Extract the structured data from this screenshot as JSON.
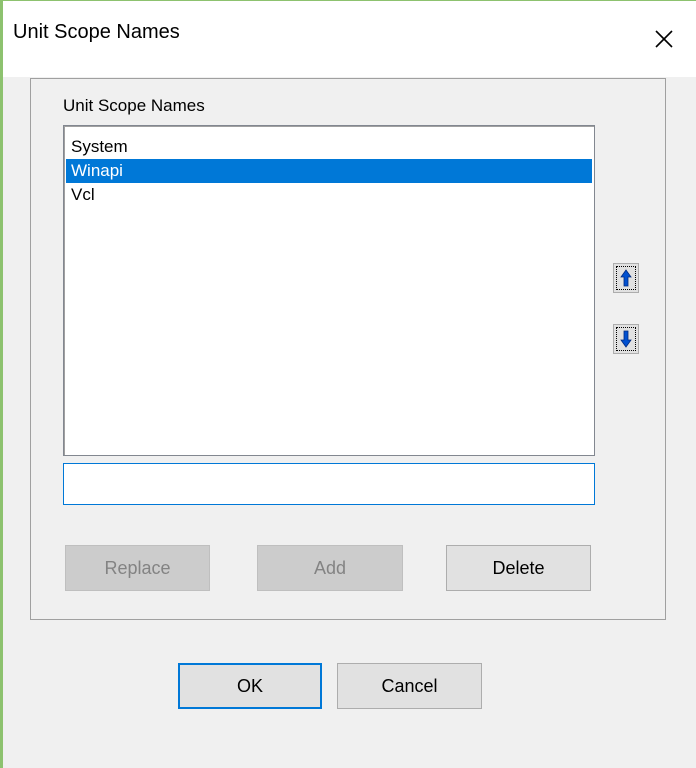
{
  "window": {
    "title": "Unit Scope Names",
    "close_icon": "close-icon"
  },
  "group": {
    "label": "Unit Scope Names"
  },
  "list": {
    "items": [
      {
        "label": "System",
        "selected": false
      },
      {
        "label": "Winapi",
        "selected": true
      },
      {
        "label": "Vcl",
        "selected": false
      }
    ]
  },
  "arrows": {
    "up_icon": "arrow-up-icon",
    "down_icon": "arrow-down-icon",
    "color": "#0050d0"
  },
  "input": {
    "value": "",
    "placeholder": ""
  },
  "buttons": {
    "replace": "Replace",
    "add": "Add",
    "delete": "Delete",
    "ok": "OK",
    "cancel": "Cancel"
  },
  "colors": {
    "selection": "#0078d7",
    "accent": "#0078d7",
    "window_border": "#8dc26f"
  }
}
